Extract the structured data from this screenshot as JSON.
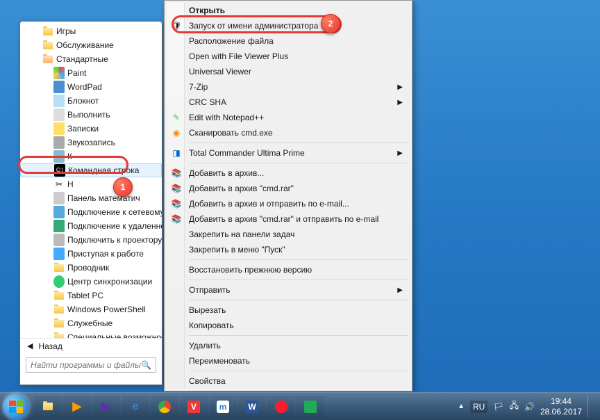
{
  "startmenu": {
    "folders_top": [
      "Игры",
      "Обслуживание"
    ],
    "expanded_folder": "Стандартные",
    "programs": [
      "Paint",
      "WordPad",
      "Блокнот",
      "Выполнить",
      "Записки",
      "Звукозапись",
      "К",
      "Командная строка",
      "Н",
      "Панель математич",
      "Подключение к сетевому",
      "Подключение к удаленно",
      "Подключить к проектору",
      "Приступая к работе",
      "Проводник",
      "Центр синхронизации"
    ],
    "subfolders": [
      "Tablet PC",
      "Windows PowerShell",
      "Служебные",
      "Специальные возможност"
    ],
    "back": "Назад",
    "search_placeholder": "Найти программы и файлы"
  },
  "ctx": {
    "open": "Открыть",
    "runas": "Запуск от имени администратора",
    "file_loc": "Расположение файла",
    "fvplus": "Open with File Viewer Plus",
    "uviewer": "Universal Viewer",
    "sevenzip": "7-Zip",
    "crcsha": "CRC SHA",
    "notepadpp": "Edit with Notepad++",
    "scan": "Сканировать cmd.exe",
    "tcup": "Total Commander Ultima Prime",
    "rar1": "Добавить в архив...",
    "rar2": "Добавить в архив \"cmd.rar\"",
    "rar3": "Добавить в архив и отправить по e-mail...",
    "rar4": "Добавить в архив \"cmd.rar\" и отправить по e-mail",
    "pin_tb": "Закрепить на панели задач",
    "pin_start": "Закрепить в меню \"Пуск\"",
    "restore": "Восстановить прежнюю версию",
    "sendto": "Отправить",
    "cut": "Вырезать",
    "copy": "Копировать",
    "delete": "Удалить",
    "rename": "Переименовать",
    "props": "Свойства"
  },
  "badges": {
    "b1": "1",
    "b2": "2"
  },
  "tray": {
    "lang": "RU",
    "time": "19:44",
    "date": "28.06.2017"
  }
}
